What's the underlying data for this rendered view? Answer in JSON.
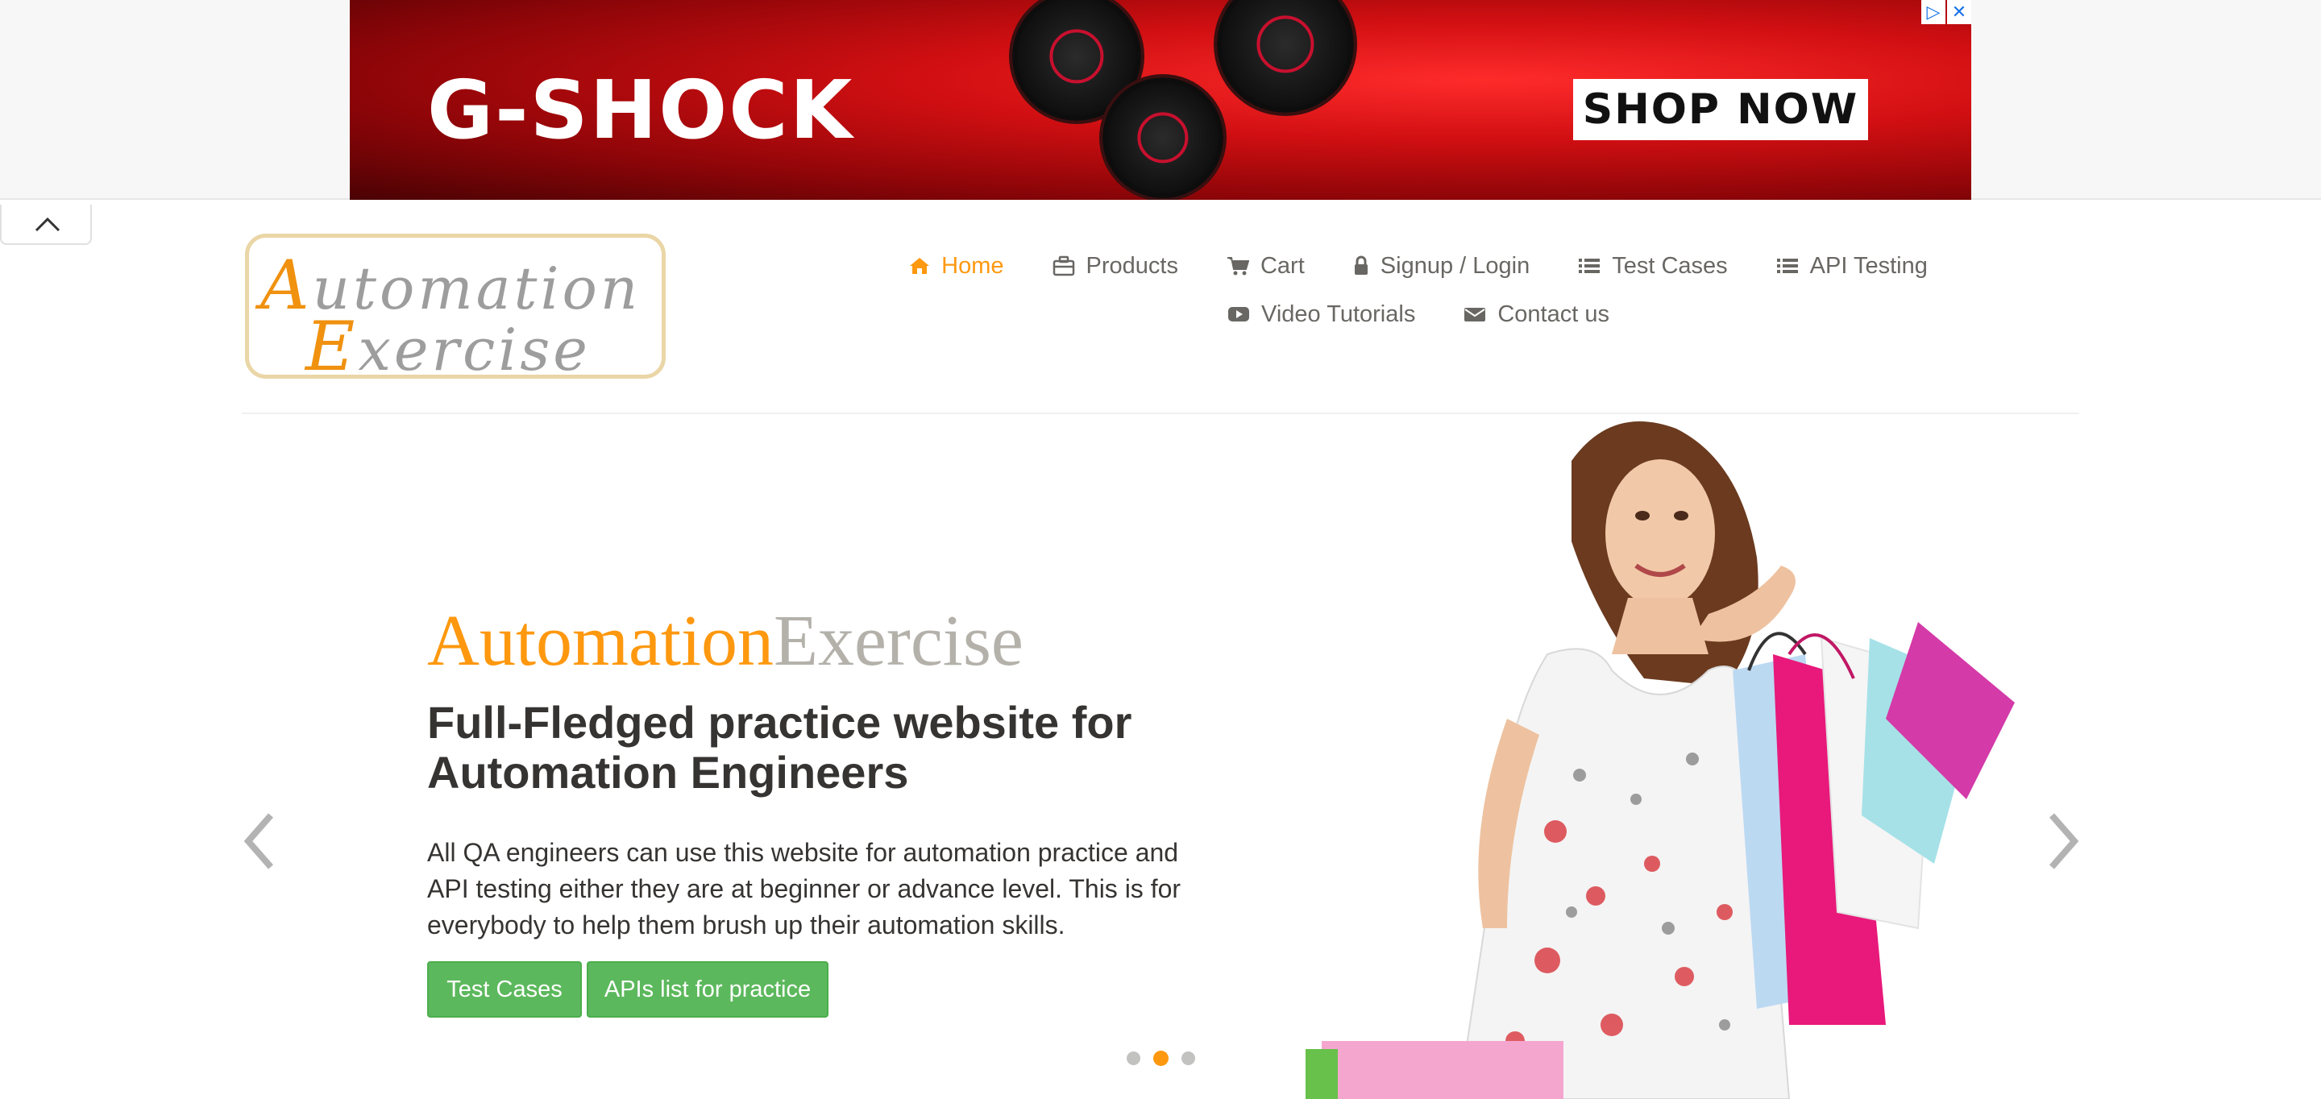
{
  "ad": {
    "brand": "G-SHOCK",
    "cta": "SHOP NOW",
    "choices_icon": "adchoices-icon",
    "close_icon": "close-icon"
  },
  "collapse": {
    "icon": "chevron-up-icon"
  },
  "logo": {
    "line1_cap": "A",
    "line1_rest": "utomation",
    "line2_cap": "E",
    "line2_rest": "xercise"
  },
  "nav": {
    "items": [
      {
        "label": "Home",
        "icon": "home-icon",
        "active": true
      },
      {
        "label": "Products",
        "icon": "briefcase-icon"
      },
      {
        "label": "Cart",
        "icon": "cart-icon"
      },
      {
        "label": "Signup / Login",
        "icon": "lock-icon"
      },
      {
        "label": "Test Cases",
        "icon": "list-icon"
      },
      {
        "label": "API Testing",
        "icon": "list-icon"
      },
      {
        "label": "Video Tutorials",
        "icon": "youtube-icon"
      },
      {
        "label": "Contact us",
        "icon": "envelope-icon"
      }
    ]
  },
  "hero": {
    "title_a": "Automation",
    "title_b": "Exercise",
    "subtitle": "Full-Fledged practice website for Automation Engineers",
    "description": "All QA engineers can use this website for automation practice and API testing either they are at beginner or advance level. This is for everybody to help them brush up their automation skills.",
    "btn_test_cases": "Test Cases",
    "btn_apis": "APIs list for practice",
    "slides_total": 3,
    "active_slide": 2
  },
  "colors": {
    "accent": "#fe980f",
    "green": "#5cb85c",
    "text": "#696763",
    "dark": "#363432"
  }
}
